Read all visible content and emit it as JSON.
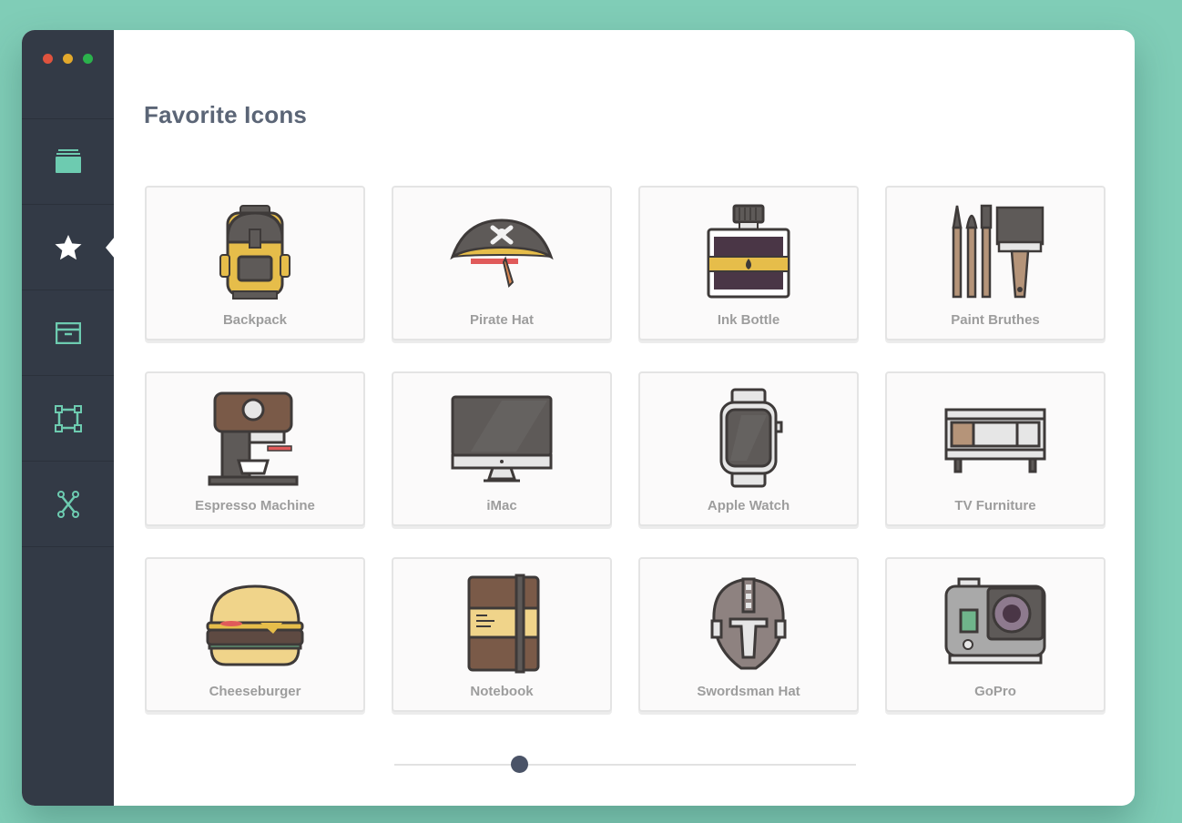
{
  "window": {
    "controls": [
      "close",
      "minimize",
      "maximize"
    ]
  },
  "sidebar": {
    "items": [
      {
        "name": "sidebar-item-library",
        "icon": "stack-icon"
      },
      {
        "name": "sidebar-item-favorites",
        "icon": "star-icon",
        "active": true
      },
      {
        "name": "sidebar-item-archive",
        "icon": "archive-box-icon"
      },
      {
        "name": "sidebar-item-artboard",
        "icon": "artboard-frame-icon"
      },
      {
        "name": "sidebar-item-vector",
        "icon": "vector-path-icon"
      }
    ],
    "colors": {
      "background": "#333a46",
      "icon": "#6dcbb0",
      "active_icon": "#ffffff"
    }
  },
  "main": {
    "title": "Favorite Icons",
    "cards": [
      {
        "label": "Backpack",
        "icon": "backpack-icon"
      },
      {
        "label": "Pirate Hat",
        "icon": "pirate-hat-icon"
      },
      {
        "label": "Ink Bottle",
        "icon": "ink-bottle-icon"
      },
      {
        "label": "Paint Bruthes",
        "icon": "paint-brushes-icon"
      },
      {
        "label": "Espresso Machine",
        "icon": "espresso-machine-icon"
      },
      {
        "label": "iMac",
        "icon": "imac-icon"
      },
      {
        "label": "Apple Watch",
        "icon": "apple-watch-icon"
      },
      {
        "label": "TV Furniture",
        "icon": "tv-furniture-icon"
      },
      {
        "label": "Cheeseburger",
        "icon": "cheeseburger-icon"
      },
      {
        "label": "Notebook",
        "icon": "notebook-icon"
      },
      {
        "label": "Swordsman Hat",
        "icon": "swordsman-helmet-icon"
      },
      {
        "label": "GoPro",
        "icon": "gopro-camera-icon"
      }
    ]
  },
  "slider": {
    "value": 0.27
  },
  "colors": {
    "background": "#80cdb7",
    "title": "#5b6576",
    "label": "#9d9d9d",
    "slider_thumb": "#4a5367"
  }
}
